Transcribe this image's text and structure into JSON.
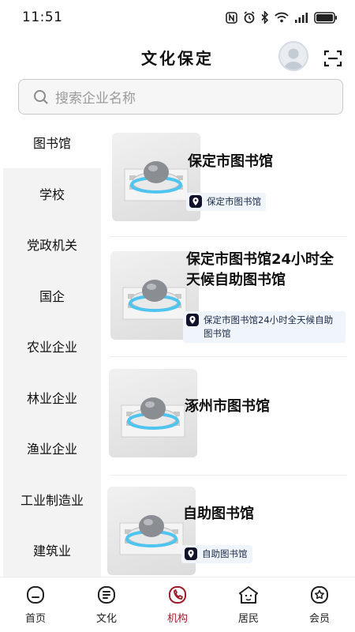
{
  "status_bar": {
    "time": "11:51",
    "icons": [
      "nfc-icon",
      "alarm-icon",
      "bluetooth-icon",
      "wifi-icon",
      "signal-icon",
      "battery-icon"
    ]
  },
  "header": {
    "title": "文化保定",
    "avatar_icon": "user-avatar-icon",
    "scan_icon": "scan-icon"
  },
  "search": {
    "placeholder": "搜索企业名称",
    "icon": "search-icon"
  },
  "sidebar": {
    "categories": [
      {
        "label": "图书馆",
        "active": true
      },
      {
        "label": "学校",
        "active": false
      },
      {
        "label": "党政机关",
        "active": false
      },
      {
        "label": "国企",
        "active": false
      },
      {
        "label": "农业企业",
        "active": false
      },
      {
        "label": "林业企业",
        "active": false
      },
      {
        "label": "渔业企业",
        "active": false
      },
      {
        "label": "工业制造业",
        "active": false
      },
      {
        "label": "建筑业",
        "active": false
      }
    ]
  },
  "list": {
    "items": [
      {
        "title": "保定市图书馆",
        "tag": "保定市图书馆"
      },
      {
        "title": "保定市图书馆24小时全天候自助图书馆",
        "tag": "保定市图书馆24小时全天候自助图书馆"
      },
      {
        "title": "涿州市图书馆",
        "tag": ""
      },
      {
        "title": "自助图书馆",
        "tag": "自助图书馆"
      }
    ]
  },
  "tabbar": {
    "tabs": [
      {
        "label": "首页",
        "icon": "home-icon",
        "active": false
      },
      {
        "label": "文化",
        "icon": "culture-icon",
        "active": false
      },
      {
        "label": "机构",
        "icon": "institution-icon",
        "active": true
      },
      {
        "label": "居民",
        "icon": "resident-icon",
        "active": false
      },
      {
        "label": "会员",
        "icon": "member-icon",
        "active": false
      }
    ]
  },
  "colors": {
    "accent": "#9c1d2b",
    "sidebar_bg": "#f3f3f3",
    "tag_bg": "#f0f5fb",
    "tag_icon": "#12122a"
  }
}
